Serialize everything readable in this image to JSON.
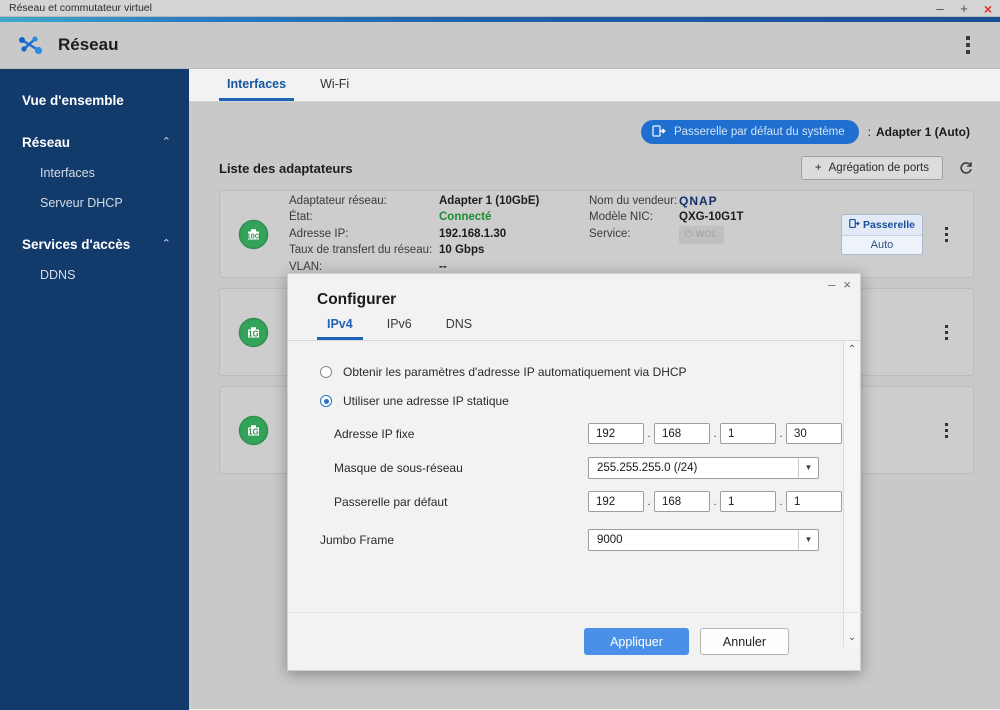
{
  "window": {
    "title": "Réseau et commutateur virtuel",
    "minimize": "–",
    "maximize": "+",
    "close": "×"
  },
  "header": {
    "app_title": "Réseau",
    "icon": "network-graph-icon",
    "menu_icon": "kebab-menu-icon"
  },
  "sidebar": {
    "overview_label": "Vue d'ensemble",
    "groups": [
      {
        "label": "Réseau",
        "chevron": "⌃",
        "items": [
          {
            "label": "Interfaces"
          },
          {
            "label": "Serveur DHCP"
          }
        ]
      },
      {
        "label": "Services d'accès",
        "chevron": "⌃",
        "items": [
          {
            "label": "DDNS"
          }
        ]
      }
    ]
  },
  "tabs": [
    {
      "label": "Interfaces",
      "active": true
    },
    {
      "label": "Wi-Fi",
      "active": false
    }
  ],
  "gateway": {
    "pill_label": "Passerelle par défaut du système",
    "pill_icon": "gateway-icon",
    "separator": ":",
    "value": "Adapter 1 (Auto)"
  },
  "adapter_list": {
    "title": "Liste des adaptateurs",
    "aggregation_button": "Agrégation de ports",
    "aggregation_plus": "+",
    "refresh_icon": "refresh-icon"
  },
  "cards": [
    {
      "badge": "10G",
      "left": [
        {
          "key": "Adaptateur réseau:",
          "value": "Adapter 1 (10GbE)",
          "green": false
        },
        {
          "key": "État:",
          "value": "Connecté",
          "green": true
        },
        {
          "key": "Adresse IP:",
          "value": "192.168.1.30",
          "green": false
        },
        {
          "key": "Taux de transfert du réseau:",
          "value": "10 Gbps",
          "green": false
        },
        {
          "key": "VLAN:",
          "value": "--",
          "green": false
        }
      ],
      "right": [
        {
          "key": "Nom du vendeur:",
          "value": "QNAP",
          "type": "logo"
        },
        {
          "key": "Modèle NIC:",
          "value": "QXG-10G1T",
          "type": "text"
        },
        {
          "key": "Service:",
          "value": "WOL",
          "type": "badge"
        }
      ],
      "gateway_button": {
        "top": "Passerelle",
        "bottom": "Auto"
      }
    },
    {
      "badge": "1G"
    },
    {
      "badge": "1G"
    }
  ],
  "modal": {
    "title": "Configurer",
    "minimize": "–",
    "close": "×",
    "tabs": [
      {
        "label": "IPv4",
        "active": true
      },
      {
        "label": "IPv6",
        "active": false
      },
      {
        "label": "DNS",
        "active": false
      }
    ],
    "radio_dhcp": "Obtenir les paramètres d'adresse IP automatiquement via DHCP",
    "radio_static": "Utiliser une adresse IP statique",
    "radio_selected": "static",
    "fields": {
      "ip_label": "Adresse IP fixe",
      "ip_octets": [
        "192",
        "168",
        "1",
        "30"
      ],
      "mask_label": "Masque de sous-réseau",
      "mask_value": "255.255.255.0 (/24)",
      "gateway_label": "Passerelle par défaut",
      "gateway_octets": [
        "192",
        "168",
        "1",
        "1"
      ],
      "jumbo_label": "Jumbo Frame",
      "jumbo_value": "9000"
    },
    "scroll_up": "⌃",
    "scroll_down": "⌄",
    "apply_button": "Appliquer",
    "cancel_button": "Annuler"
  },
  "colors": {
    "sidebar_bg": "#123a6b",
    "accent_blue": "#1f63b5",
    "primary_button": "#4a90e8",
    "status_green": "#1d8b34",
    "gateway_pill": "#1f6fd0"
  }
}
